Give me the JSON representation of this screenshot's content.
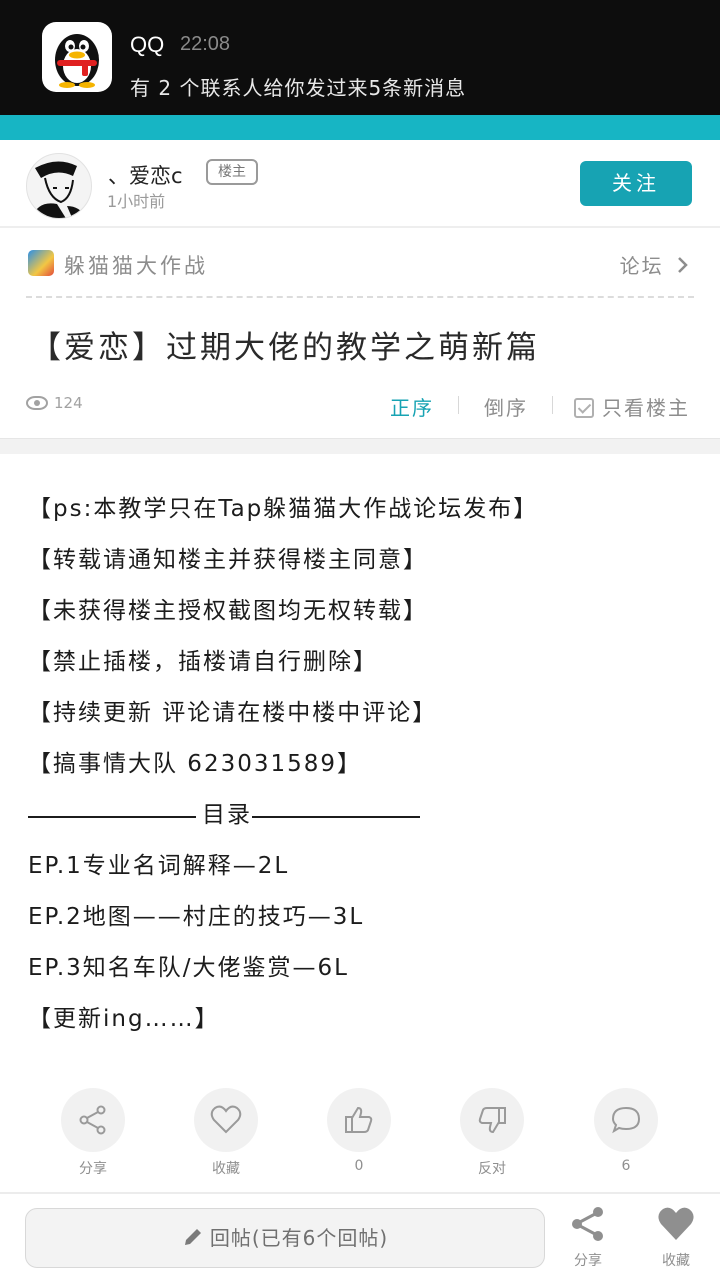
{
  "notification": {
    "app_name": "QQ",
    "time": "22:08",
    "message": "有 2 个联系人给你发过来5条新消息",
    "icon": "qq-penguin-icon"
  },
  "author": {
    "name": "、爱恋c",
    "badge": "楼主",
    "time_ago": "1小时前",
    "follow_label": "关注"
  },
  "forum": {
    "name": "躲猫猫大作战",
    "link_label": "论坛"
  },
  "post": {
    "title": "【爱恋】过期大佬的教学之萌新篇",
    "views": "124",
    "sort_asc": "正序",
    "sort_desc": "倒序",
    "only_owner": "只看楼主",
    "lines": [
      "【ps:本教学只在Tap躲猫猫大作战论坛发布】",
      "【转载请通知楼主并获得楼主同意】",
      "【未获得楼主授权截图均无权转载】",
      "【禁止插楼，插楼请自行删除】",
      "【持续更新 评论请在楼中楼中评论】",
      "【搞事情大队 623031589】"
    ],
    "toc_label": "目录",
    "toc": [
      "EP.1专业名词解释—2L",
      "EP.2地图——村庄的技巧—3L",
      "EP.3知名车队/大佬鉴赏—6L",
      "【更新ing……】"
    ]
  },
  "actions": {
    "share": "分享",
    "favorite": "收藏",
    "like_count": "0",
    "oppose": "反对",
    "comment_count": "6"
  },
  "bottom_bar": {
    "reply_placeholder": "回帖(已有6个回帖)",
    "share": "分享",
    "favorite": "收藏"
  },
  "colors": {
    "accent": "#17a3b3",
    "strip": "#17b5c4",
    "notification_bg": "#0d0d0d"
  }
}
